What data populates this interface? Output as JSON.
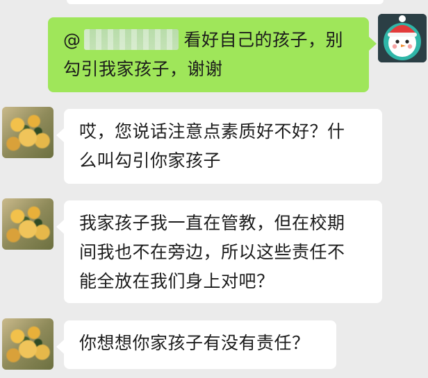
{
  "messages": [
    {
      "from": "me",
      "mention": "@",
      "lines": [
        "看好自己的孩子，别",
        "勾引我家孩子，谢谢"
      ]
    },
    {
      "from": "friend",
      "lines": [
        "哎，您说话注意点素质好不好？什",
        "么叫勾引你家孩子"
      ]
    },
    {
      "from": "friend",
      "lines": [
        "我家孩子我一直在管教，但在校期",
        "间我也不在旁边，所以这些责任不",
        "能全放在我们身上对吧？"
      ]
    },
    {
      "from": "friend",
      "lines": [
        "你想想你家孩子有没有责任？"
      ]
    }
  ],
  "colors": {
    "chat_background": "#ebebeb",
    "outgoing_bubble": "#9fe65a",
    "incoming_bubble": "#ffffff"
  },
  "icons": {
    "my_avatar": "snowman-avatar-icon",
    "friend_avatar": "flower-bouquet-avatar-icon"
  }
}
